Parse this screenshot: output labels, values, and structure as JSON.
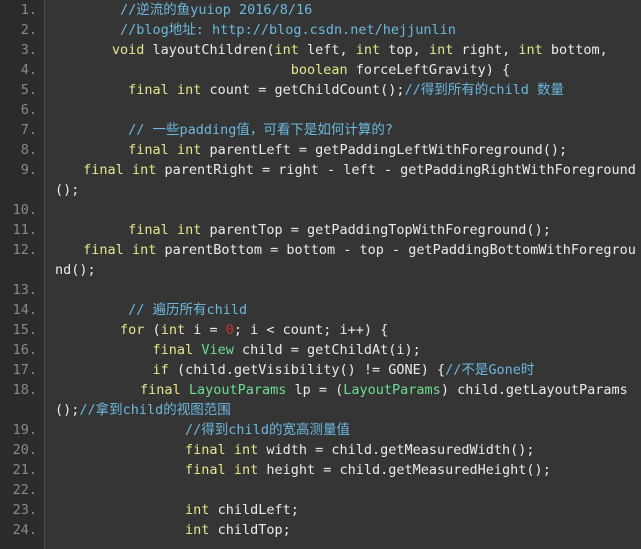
{
  "editor": {
    "name": "code-block-viewer",
    "language": "java",
    "theme": {
      "background": "#353535",
      "gutter_background": "#2b2b2b",
      "gutter_divider": "#4a4a4a",
      "line_number_color": "#8a8a8a",
      "default_text": "#eaeaea",
      "keyword": "#e5e58c",
      "comment": "#6cb8dd",
      "type": "#6edd90",
      "number": "#cc3333"
    },
    "first_line_number": 1,
    "last_line_number": 24
  },
  "lines": [
    {
      "number": "1.",
      "wrapped": false,
      "tokens": [
        {
          "text": "        ",
          "style": "plain"
        },
        {
          "text": "//逆流的鱼yuiop 2016/8/16",
          "style": "comment"
        }
      ]
    },
    {
      "number": "2.",
      "wrapped": false,
      "tokens": [
        {
          "text": "        ",
          "style": "plain"
        },
        {
          "text": "//blog地址: http://blog.csdn.net/hejjunlin",
          "style": "comment"
        }
      ]
    },
    {
      "number": "3.",
      "wrapped": false,
      "tokens": [
        {
          "text": "       ",
          "style": "plain"
        },
        {
          "text": "void",
          "style": "keyword"
        },
        {
          "text": " layoutChildren(",
          "style": "plain"
        },
        {
          "text": "int",
          "style": "keyword"
        },
        {
          "text": " left, ",
          "style": "plain"
        },
        {
          "text": "int",
          "style": "keyword"
        },
        {
          "text": " top, ",
          "style": "plain"
        },
        {
          "text": "int",
          "style": "keyword"
        },
        {
          "text": " right, ",
          "style": "plain"
        },
        {
          "text": "int",
          "style": "keyword"
        },
        {
          "text": " bottom,",
          "style": "plain"
        }
      ]
    },
    {
      "number": "4.",
      "wrapped": false,
      "tokens": [
        {
          "text": "                             ",
          "style": "plain"
        },
        {
          "text": "boolean",
          "style": "keyword"
        },
        {
          "text": " forceLeftGravity) {",
          "style": "plain"
        }
      ]
    },
    {
      "number": "5.",
      "wrapped": false,
      "tokens": [
        {
          "text": "         ",
          "style": "plain"
        },
        {
          "text": "final",
          "style": "keyword"
        },
        {
          "text": " ",
          "style": "plain"
        },
        {
          "text": "int",
          "style": "keyword"
        },
        {
          "text": " count = getChildCount();",
          "style": "plain"
        },
        {
          "text": "//得到所有的child 数量",
          "style": "comment"
        }
      ]
    },
    {
      "number": "6.",
      "wrapped": false,
      "tokens": [
        {
          "text": "",
          "style": "plain"
        }
      ]
    },
    {
      "number": "7.",
      "wrapped": false,
      "tokens": [
        {
          "text": "         ",
          "style": "plain"
        },
        {
          "text": "// 一些padding值，可看下是如何计算的?",
          "style": "comment"
        }
      ]
    },
    {
      "number": "8.",
      "wrapped": false,
      "tokens": [
        {
          "text": "         ",
          "style": "plain"
        },
        {
          "text": "final",
          "style": "keyword"
        },
        {
          "text": " ",
          "style": "plain"
        },
        {
          "text": "int",
          "style": "keyword"
        },
        {
          "text": " parentLeft = getPaddingLeftWithForeground();",
          "style": "plain"
        }
      ]
    },
    {
      "number": "9.",
      "wrapped": true,
      "tokens": [
        {
          "text": "         ",
          "style": "plain"
        },
        {
          "text": "final",
          "style": "keyword"
        },
        {
          "text": " ",
          "style": "plain"
        },
        {
          "text": "int",
          "style": "keyword"
        },
        {
          "text": " parentRight = right - left - getPaddingRightWithForeground();",
          "style": "plain"
        }
      ]
    },
    {
      "number": "10.",
      "wrapped": false,
      "tokens": [
        {
          "text": "",
          "style": "plain"
        }
      ]
    },
    {
      "number": "11.",
      "wrapped": false,
      "tokens": [
        {
          "text": "         ",
          "style": "plain"
        },
        {
          "text": "final",
          "style": "keyword"
        },
        {
          "text": " ",
          "style": "plain"
        },
        {
          "text": "int",
          "style": "keyword"
        },
        {
          "text": " parentTop = getPaddingTopWithForeground();",
          "style": "plain"
        }
      ]
    },
    {
      "number": "12.",
      "wrapped": true,
      "tokens": [
        {
          "text": "         ",
          "style": "plain"
        },
        {
          "text": "final",
          "style": "keyword"
        },
        {
          "text": " ",
          "style": "plain"
        },
        {
          "text": "int",
          "style": "keyword"
        },
        {
          "text": " parentBottom = bottom - top - getPaddingBottomWithForeground();",
          "style": "plain"
        }
      ]
    },
    {
      "number": "13.",
      "wrapped": false,
      "tokens": [
        {
          "text": "",
          "style": "plain"
        }
      ]
    },
    {
      "number": "14.",
      "wrapped": false,
      "tokens": [
        {
          "text": "         ",
          "style": "plain"
        },
        {
          "text": "// 遍历所有child",
          "style": "comment"
        }
      ]
    },
    {
      "number": "15.",
      "wrapped": false,
      "tokens": [
        {
          "text": "        ",
          "style": "plain"
        },
        {
          "text": "for",
          "style": "keyword"
        },
        {
          "text": " (",
          "style": "plain"
        },
        {
          "text": "int",
          "style": "keyword"
        },
        {
          "text": " i = ",
          "style": "plain"
        },
        {
          "text": "0",
          "style": "number"
        },
        {
          "text": "; i < count; i++) {",
          "style": "plain"
        }
      ]
    },
    {
      "number": "16.",
      "wrapped": false,
      "tokens": [
        {
          "text": "            ",
          "style": "plain"
        },
        {
          "text": "final",
          "style": "keyword"
        },
        {
          "text": " ",
          "style": "plain"
        },
        {
          "text": "View",
          "style": "type"
        },
        {
          "text": " child = getChildAt(i);",
          "style": "plain"
        }
      ]
    },
    {
      "number": "17.",
      "wrapped": false,
      "tokens": [
        {
          "text": "            ",
          "style": "plain"
        },
        {
          "text": "if",
          "style": "keyword"
        },
        {
          "text": " (child.getVisibility() != GONE) {",
          "style": "plain"
        },
        {
          "text": "//不是Gone时",
          "style": "comment"
        }
      ]
    },
    {
      "number": "18.",
      "wrapped": true,
      "tokens": [
        {
          "text": "                ",
          "style": "plain"
        },
        {
          "text": "final",
          "style": "keyword"
        },
        {
          "text": " ",
          "style": "plain"
        },
        {
          "text": "LayoutParams",
          "style": "type"
        },
        {
          "text": " lp = (",
          "style": "plain"
        },
        {
          "text": "LayoutParams",
          "style": "type"
        },
        {
          "text": ") child.getLayoutParams();",
          "style": "plain"
        },
        {
          "text": "//拿到child的视图范围",
          "style": "comment"
        }
      ]
    },
    {
      "number": "19.",
      "wrapped": false,
      "tokens": [
        {
          "text": "                ",
          "style": "plain"
        },
        {
          "text": "//得到child的宽高测量值",
          "style": "comment"
        }
      ]
    },
    {
      "number": "20.",
      "wrapped": false,
      "tokens": [
        {
          "text": "                ",
          "style": "plain"
        },
        {
          "text": "final",
          "style": "keyword"
        },
        {
          "text": " ",
          "style": "plain"
        },
        {
          "text": "int",
          "style": "keyword"
        },
        {
          "text": " width = child.getMeasuredWidth();",
          "style": "plain"
        }
      ]
    },
    {
      "number": "21.",
      "wrapped": false,
      "tokens": [
        {
          "text": "                ",
          "style": "plain"
        },
        {
          "text": "final",
          "style": "keyword"
        },
        {
          "text": " ",
          "style": "plain"
        },
        {
          "text": "int",
          "style": "keyword"
        },
        {
          "text": " height = child.getMeasuredHeight();",
          "style": "plain"
        }
      ]
    },
    {
      "number": "22.",
      "wrapped": false,
      "tokens": [
        {
          "text": "",
          "style": "plain"
        }
      ]
    },
    {
      "number": "23.",
      "wrapped": false,
      "tokens": [
        {
          "text": "                ",
          "style": "plain"
        },
        {
          "text": "int",
          "style": "keyword"
        },
        {
          "text": " childLeft;",
          "style": "plain"
        }
      ]
    },
    {
      "number": "24.",
      "wrapped": false,
      "tokens": [
        {
          "text": "                ",
          "style": "plain"
        },
        {
          "text": "int",
          "style": "keyword"
        },
        {
          "text": " childTop;",
          "style": "plain"
        }
      ]
    }
  ]
}
